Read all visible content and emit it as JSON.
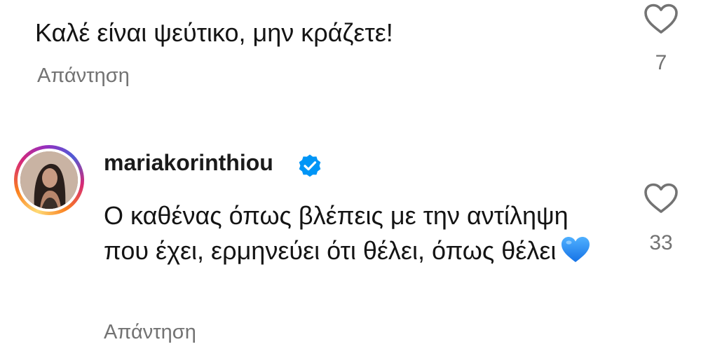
{
  "comment_1": {
    "text": "Καλέ είναι ψεύτικο, μην κράζετε!",
    "reply_label": "Απάντηση",
    "like_count": "7"
  },
  "comment_2": {
    "username": "mariakorinthiou",
    "verified": true,
    "text": "Ο καθένας όπως βλέπεις με την αντίληψη που έχει, ερμηνεύει ότι θέλει, όπως θέλει",
    "emoji": "blue-heart",
    "reply_label": "Απάντηση",
    "like_count": "33"
  },
  "colors": {
    "text": "#141414",
    "muted": "#737373",
    "verified": "#0095f6",
    "heart_emoji": "#1f8fff"
  },
  "icons": {
    "like": "heart-outline-icon",
    "verified": "verified-badge-icon",
    "emoji": "blue-heart-emoji"
  }
}
